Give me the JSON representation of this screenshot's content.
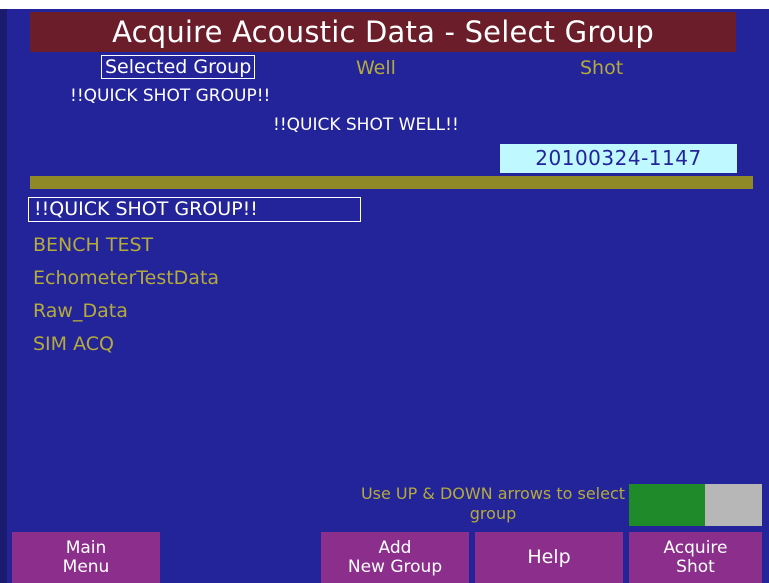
{
  "title": "Acquire Acoustic Data - Select Group",
  "headers": {
    "selected_group": "Selected Group",
    "well": "Well",
    "shot": "Shot"
  },
  "current": {
    "group": "!!QUICK SHOT GROUP!!",
    "well": "!!QUICK SHOT WELL!!",
    "shot_id": "20100324-1147"
  },
  "groups": [
    "!!QUICK SHOT GROUP!!",
    "BENCH TEST",
    "EchometerTestData",
    "Raw_Data",
    "SIM ACQ"
  ],
  "selected_group_index": 0,
  "hint": "Use UP & DOWN arrows to select group",
  "function_keys": {
    "main_menu": [
      "Main",
      "Menu"
    ],
    "add_group": [
      "Add",
      "New Group"
    ],
    "help": "Help",
    "acquire": [
      "Acquire",
      "Shot"
    ]
  },
  "colors": {
    "background": "#23239a",
    "title_bar": "#6b1d2a",
    "label_olive": "#b5ab3a",
    "divider": "#8f8a27",
    "shot_field": "#bff9ff",
    "function_key": "#8b2e8c",
    "status_green": "#1f8a2a",
    "status_gray": "#b7b7b7"
  }
}
